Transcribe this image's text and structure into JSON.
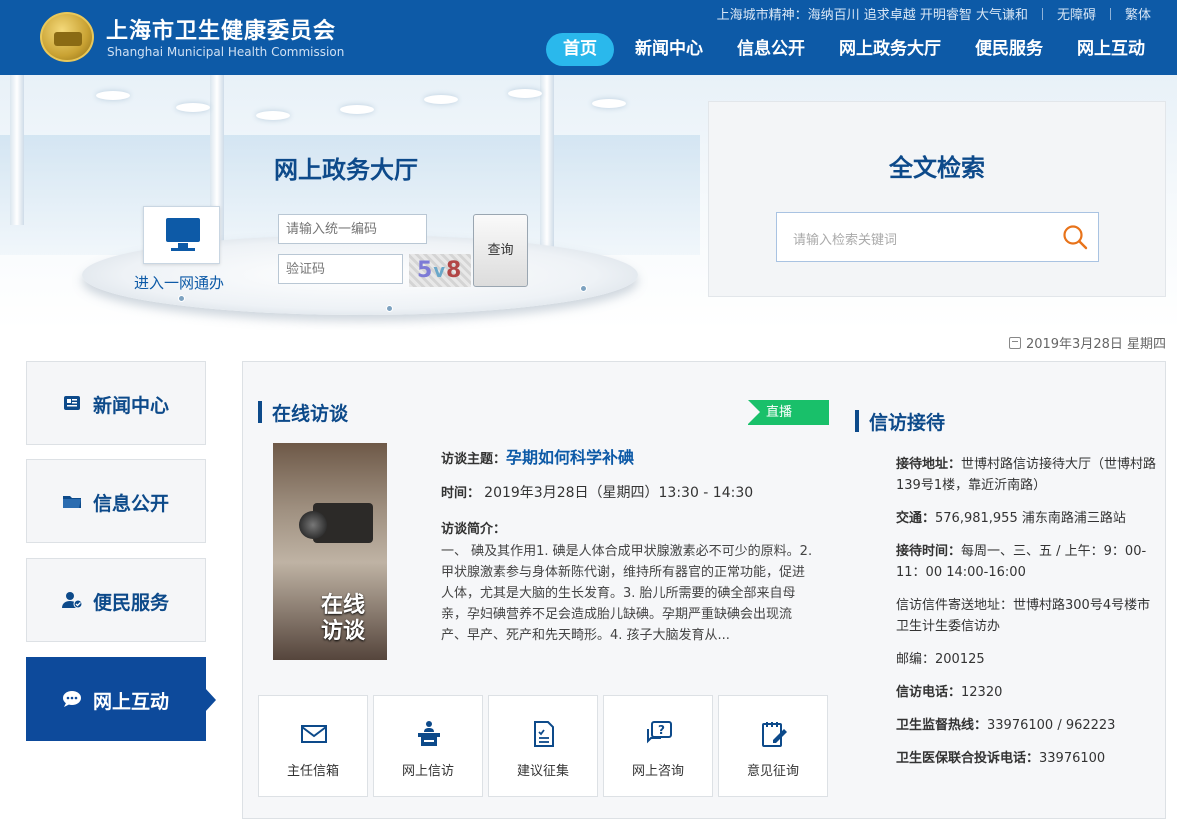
{
  "header": {
    "site_title": "上海市卫生健康委员会",
    "site_subtitle": "Shanghai Municipal Health Commission",
    "top_links": {
      "city_spirit": "上海城市精神：海纳百川 追求卓越 开明睿智 大气谦和",
      "accessibility": "无障碍",
      "traditional": "繁体"
    },
    "nav": [
      {
        "label": "首页",
        "active": true
      },
      {
        "label": "新闻中心",
        "active": false
      },
      {
        "label": "信息公开",
        "active": false
      },
      {
        "label": "网上政务大厅",
        "active": false
      },
      {
        "label": "便民服务",
        "active": false
      },
      {
        "label": "网上互动",
        "active": false
      }
    ]
  },
  "banner": {
    "title": "网上政务大厅",
    "yiwang_label": "进入一网通办",
    "code_placeholder": "请输入统一编码",
    "captcha_placeholder": "验证码",
    "captcha_text": [
      "5",
      "v",
      "8"
    ],
    "query_button": "查询"
  },
  "search": {
    "title": "全文检索",
    "placeholder": "请输入检索关键词"
  },
  "date_line": "2019年3月28日 星期四",
  "sidebar": [
    {
      "label": "新闻中心",
      "icon": "news-icon",
      "active": false
    },
    {
      "label": "信息公开",
      "icon": "folder-icon",
      "active": false
    },
    {
      "label": "便民服务",
      "icon": "user-check-icon",
      "active": false
    },
    {
      "label": "网上互动",
      "icon": "chat-icon",
      "active": true
    }
  ],
  "interview": {
    "title": "在线访谈",
    "live_tag": "直播",
    "image_text": [
      "在线",
      "访谈"
    ],
    "topic_label": "访谈主题：",
    "topic": "孕期如何科学补碘",
    "time_label": "时间：",
    "time": "2019年3月28日（星期四）13:30 - 14:30",
    "brief_label": "访谈简介：",
    "brief": "一、 碘及其作用1. 碘是人体合成甲状腺激素必不可少的原料。2. 甲状腺激素参与身体新陈代谢，维持所有器官的正常功能，促进人体，尤其是大脑的生长发育。3. 胎儿所需要的碘全部来自母亲，孕妇碘营养不足会造成胎儿缺碘。孕期严重缺碘会出现流产、早产、死产和先天畸形。4. 孩子大脑发育从..."
  },
  "actions": [
    {
      "label": "主任信箱",
      "icon": "mail-icon"
    },
    {
      "label": "网上信访",
      "icon": "podium-icon"
    },
    {
      "label": "建议征集",
      "icon": "document-icon"
    },
    {
      "label": "网上咨询",
      "icon": "question-bubble-icon"
    },
    {
      "label": "意见征询",
      "icon": "edit-note-icon"
    }
  ],
  "petition": {
    "title": "信访接待",
    "items": [
      {
        "label": "接待地址：",
        "value": "世博村路信访接待大厅（世博村路139号1楼，靠近沂南路）"
      },
      {
        "label": "交通：",
        "value": "576,981,955 浦东南路浦三路站"
      },
      {
        "label": "接待时间：",
        "value": "每周一、三、五 / 上午：9：00-11：00 14:00-16:00"
      },
      {
        "label": "",
        "value": "信访信件寄送地址：世博村路300号4号楼市卫生计生委信访办"
      },
      {
        "label": "",
        "value": "邮编：200125"
      },
      {
        "label": "信访电话：",
        "value": "12320"
      },
      {
        "label": "卫生监督热线：",
        "value": "33976100 / 962223"
      },
      {
        "label": "卫生医保联合投诉电话：",
        "value": "33976100"
      }
    ]
  },
  "colors": {
    "header_bg": "#0d5aa7",
    "nav_active": "#2ab8ec",
    "title_blue": "#0d4a8a",
    "live_green": "#19c06a",
    "search_icon": "#e8731a"
  }
}
